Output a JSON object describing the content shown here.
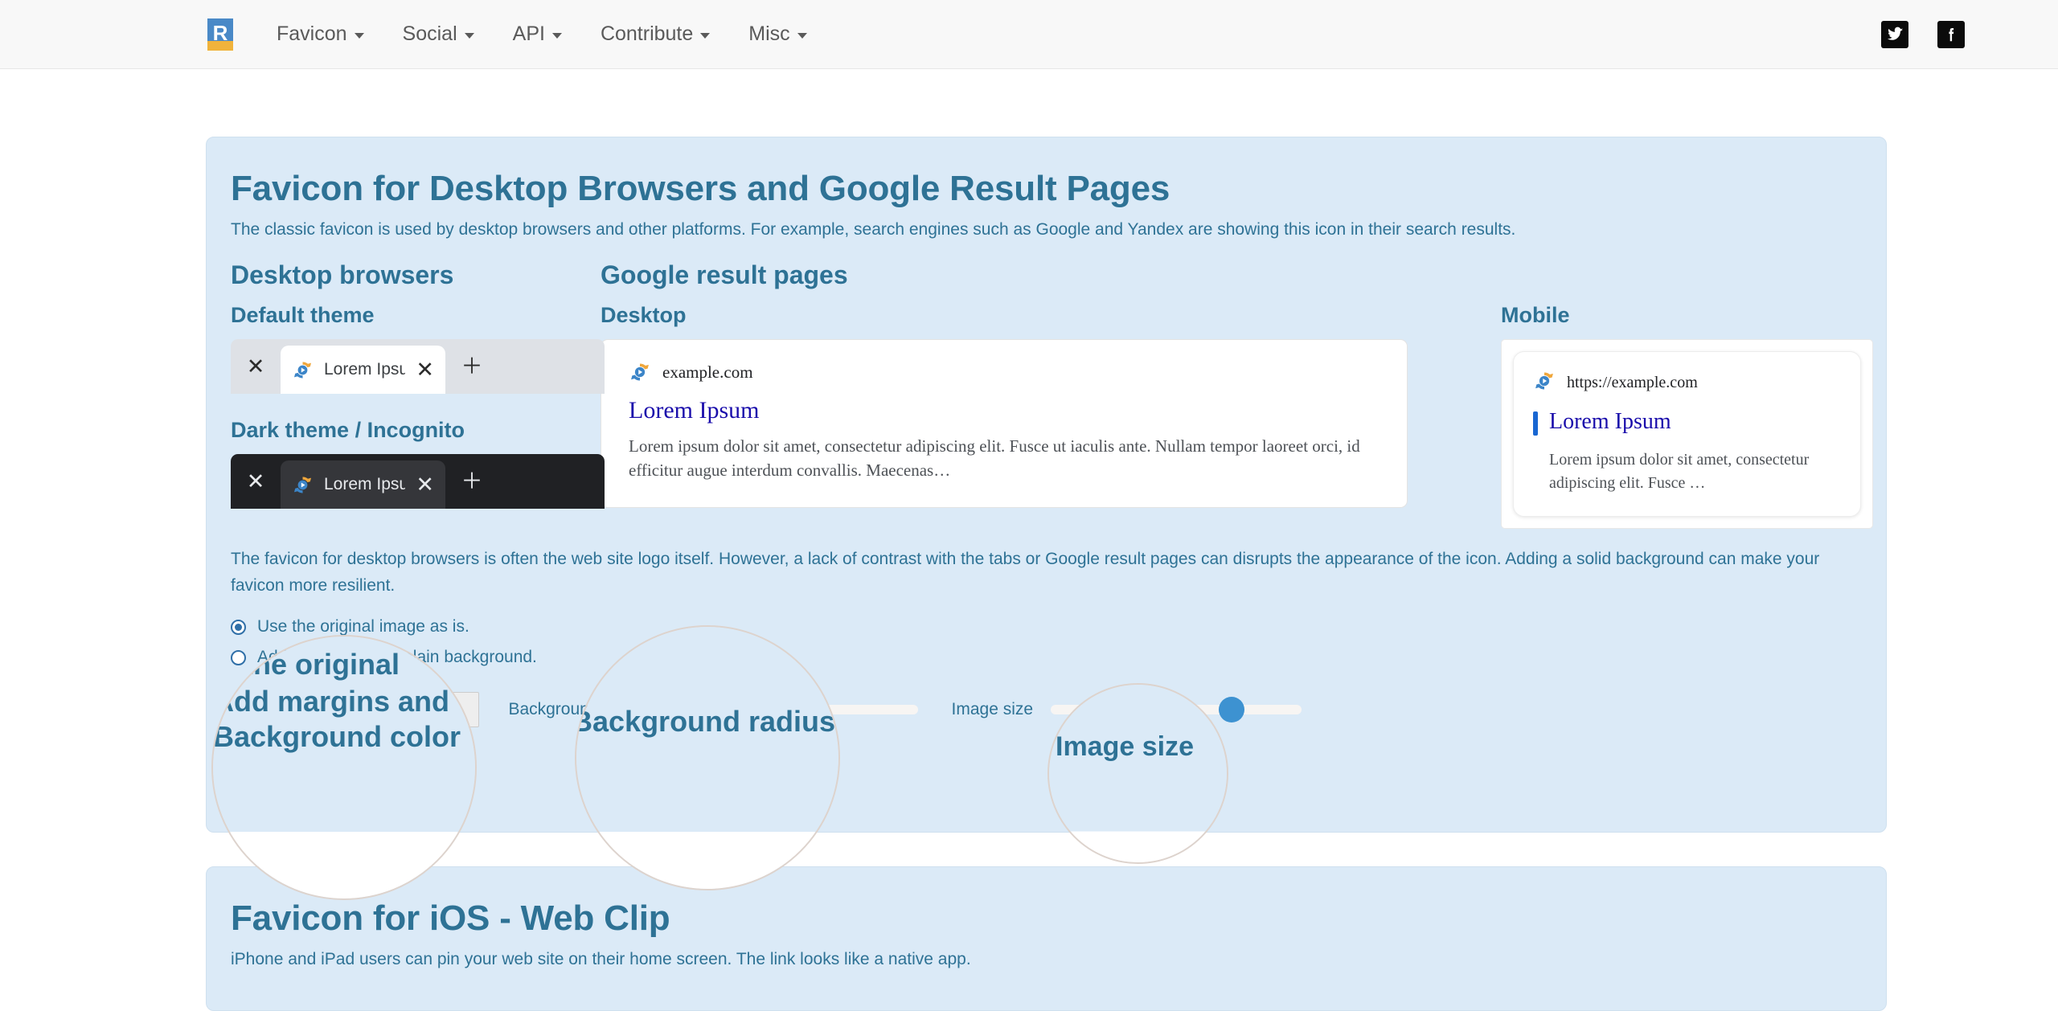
{
  "navbar": {
    "logo_name": "realfavicongenerator-logo",
    "links": [
      {
        "label": "Favicon",
        "has_caret": true
      },
      {
        "label": "Social",
        "has_caret": true
      },
      {
        "label": "API",
        "has_caret": true
      },
      {
        "label": "Contribute",
        "has_caret": true
      },
      {
        "label": "Misc",
        "has_caret": true
      }
    ],
    "social": [
      {
        "icon": "twitter-icon",
        "label": "Twitter"
      },
      {
        "icon": "facebook-icon",
        "label": "Facebook"
      }
    ]
  },
  "panel1": {
    "title": "Favicon for Desktop Browsers and Google Result Pages",
    "lead": "The classic favicon is used by desktop browsers and other platforms. For example, search engines such as Google and Yandex are showing this icon in their search results.",
    "desktop_browsers": {
      "heading": "Desktop browsers",
      "default_theme_label": "Default theme",
      "dark_theme_label": "Dark theme / Incognito",
      "tab_title": "Lorem Ipsum",
      "close_glyph": "✕",
      "plus_glyph": "＋"
    },
    "google": {
      "heading": "Google result pages",
      "desktop_label": "Desktop",
      "desktop_card": {
        "site": "example.com",
        "title": "Lorem Ipsum",
        "desc": "Lorem ipsum dolor sit amet, consectetur adipiscing elit. Fusce ut iaculis ante. Nullam tempor laoreet orci, id efficitur augue interdum convallis. Maecenas…"
      },
      "mobile_label": "Mobile",
      "mobile_card": {
        "url": "https://example.com",
        "title": "Lorem Ipsum",
        "desc": "Lorem ipsum dolor sit amet, consectetur adipiscing elit. Fusce …"
      }
    },
    "paragraph": "The favicon for desktop browsers is often the web site logo itself. However, a lack of contrast with the tabs or Google result pages can disrupts the appearance of the icon. Adding a solid background can make your favicon more resilient.",
    "options": [
      {
        "label": "Use the original image as is.",
        "selected": true
      },
      {
        "label": "Add margins and a plain background.",
        "selected": false
      }
    ],
    "controls": {
      "background_color_label": "Background color",
      "background_color_value": "#333333",
      "background_color_visible": "33333",
      "background_radius_label": "Background radius",
      "background_radius_pos_pct": 38,
      "image_size_label": "Image size",
      "image_size_pos_pct": 72
    }
  },
  "panel2": {
    "title": "Favicon for iOS - Web Clip",
    "lead": "iPhone and iPad users can pin your web site on their home screen. The link looks like a native app."
  },
  "magnifiers": [
    {
      "name": "magnifier-original-option",
      "lines": [
        "g the original",
        "Add margins and",
        "Background color"
      ]
    },
    {
      "name": "magnifier-background-radius",
      "lines": [
        "Background radius"
      ]
    },
    {
      "name": "magnifier-image-size",
      "lines": [
        "Image size"
      ]
    }
  ],
  "colors": {
    "panel_bg": "#dbeaf7",
    "heading": "#2e7295",
    "navbar_bg": "#f8f8f8",
    "slider_thumb": "#3d92d1",
    "link_blue": "#1a0dab",
    "mobile_bar": "#1967d2",
    "favicon_orange": "#f0a73c",
    "favicon_blue": "#3c85c8"
  }
}
